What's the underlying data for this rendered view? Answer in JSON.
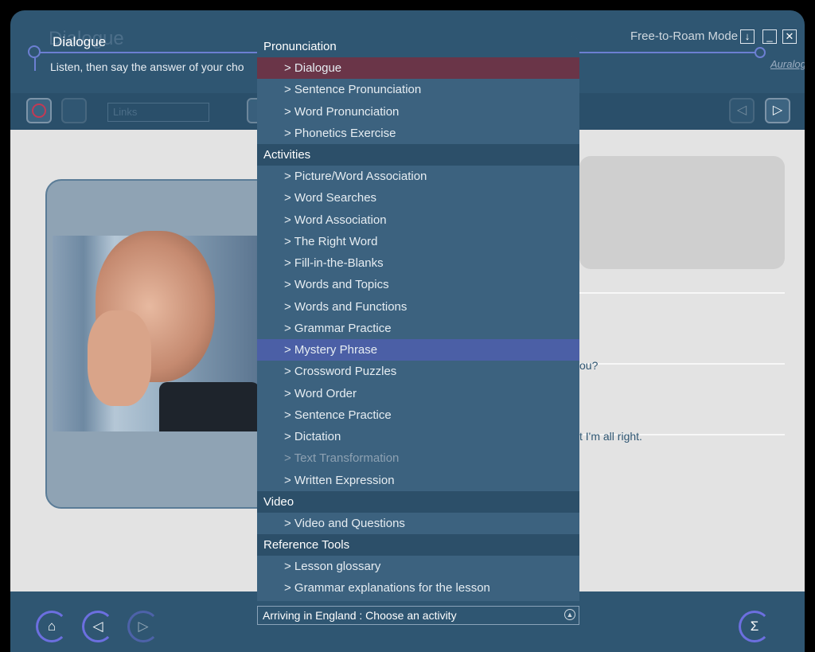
{
  "window": {
    "title": "Dialogue",
    "subtitle": "Listen, then say the answer of your cho",
    "mode_label": "Free-to-Roam Mode",
    "brand": "Auralog",
    "buttons": {
      "download": "↓",
      "minimize": "_",
      "close": "✕"
    }
  },
  "toolbar": {
    "links_placeholder": "Links",
    "record_icon": "record-icon",
    "prev_icon": "prev-icon",
    "next_icon": "next-icon"
  },
  "content": {
    "fragment_1": "ou?",
    "fragment_2": "t I'm all right."
  },
  "menu": {
    "sections": [
      {
        "header": "Pronunciation",
        "items": [
          {
            "label": "> Dialogue",
            "state": "selected"
          },
          {
            "label": "> Sentence Pronunciation",
            "state": "normal"
          },
          {
            "label": "> Word Pronunciation",
            "state": "normal"
          },
          {
            "label": "> Phonetics Exercise",
            "state": "normal"
          }
        ]
      },
      {
        "header": "Activities",
        "items": [
          {
            "label": "> Picture/Word Association",
            "state": "normal"
          },
          {
            "label": "> Word Searches",
            "state": "normal"
          },
          {
            "label": "> Word Association",
            "state": "normal"
          },
          {
            "label": "> The Right Word",
            "state": "normal"
          },
          {
            "label": "> Fill-in-the-Blanks",
            "state": "normal"
          },
          {
            "label": "> Words and Topics",
            "state": "normal"
          },
          {
            "label": "> Words and Functions",
            "state": "normal"
          },
          {
            "label": "> Grammar Practice",
            "state": "normal"
          },
          {
            "label": "> Mystery Phrase",
            "state": "hover"
          },
          {
            "label": "> Crossword Puzzles",
            "state": "normal"
          },
          {
            "label": "> Word Order",
            "state": "normal"
          },
          {
            "label": "> Sentence Practice",
            "state": "normal"
          },
          {
            "label": "> Dictation",
            "state": "normal"
          },
          {
            "label": "> Text Transformation",
            "state": "disabled"
          },
          {
            "label": "> Written Expression",
            "state": "normal"
          }
        ]
      },
      {
        "header": "Video",
        "items": [
          {
            "label": "> Video and Questions",
            "state": "normal"
          }
        ]
      },
      {
        "header": "Reference Tools",
        "items": [
          {
            "label": "> Lesson glossary",
            "state": "normal"
          },
          {
            "label": "> Grammar explanations for the lesson",
            "state": "normal"
          }
        ]
      }
    ]
  },
  "activity_select": {
    "value": "Arriving in England : Choose an activity"
  },
  "bottom_bar": {
    "home_icon": "⌂",
    "back_icon": "◁",
    "forward_icon": "▷",
    "sum_icon": "Σ"
  },
  "colors": {
    "accent": "#6c7fd2",
    "selected": "#6a3548",
    "hover": "#4b5fa6",
    "panel": "#2f5672"
  }
}
